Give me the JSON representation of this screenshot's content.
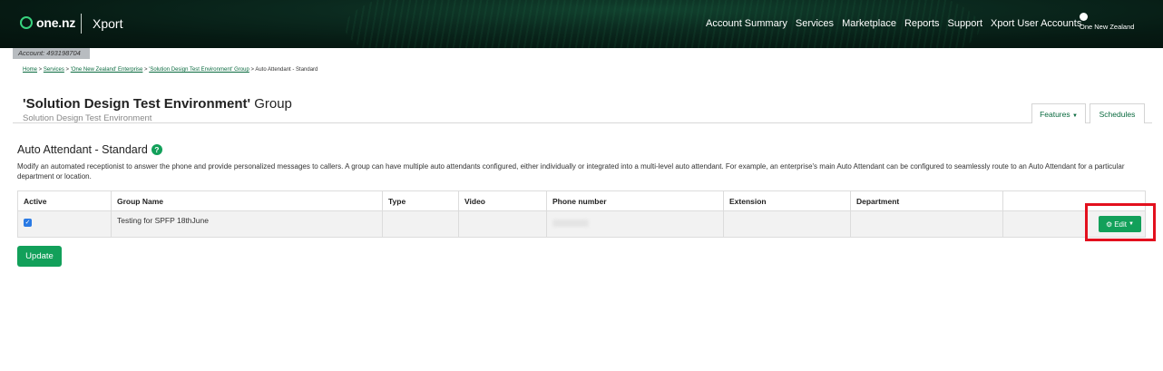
{
  "header": {
    "logo": "one.nz",
    "product": "Xport",
    "nav": [
      "Account Summary",
      "Services",
      "Marketplace",
      "Reports",
      "Support",
      "Xport User Accounts"
    ],
    "user_label": "One New Zealand"
  },
  "account": "Account: 493198704",
  "breadcrumb": {
    "items": [
      "Home",
      "Services",
      "'One New Zealand' Enterprise",
      "'Solution Design Test Environment' Group"
    ],
    "current": "Auto Attendant - Standard",
    "sep": " > "
  },
  "page": {
    "title_bold": "'Solution Design Test Environment'",
    "title_rest": " Group",
    "subtitle": "Solution Design Test Environment",
    "tabs": {
      "features": "Features",
      "schedules": "Schedules"
    }
  },
  "section": {
    "title": "Auto Attendant - Standard",
    "help": "?",
    "description": "Modify an automated receptionist to answer the phone and provide personalized messages to callers. A group can have multiple auto attendants configured, either individually or integrated into a multi-level auto attendant. For example, an enterprise's main Auto Attendant can be configured to seamlessly route to an Auto Attendant for a particular department or location."
  },
  "table": {
    "columns": [
      "Active",
      "Group Name",
      "Type",
      "Video",
      "Phone number",
      "Extension",
      "Department",
      ""
    ],
    "rows": [
      {
        "active": true,
        "group_name": "Testing for SPFP 18thJune",
        "type": "",
        "video": "",
        "phone": "",
        "extension": "",
        "department": ""
      }
    ],
    "edit_label": "Edit"
  },
  "buttons": {
    "update": "Update"
  },
  "colors": {
    "accent": "#12a05a",
    "highlight": "#e3101e",
    "header_bg": "#0b2a1f"
  }
}
